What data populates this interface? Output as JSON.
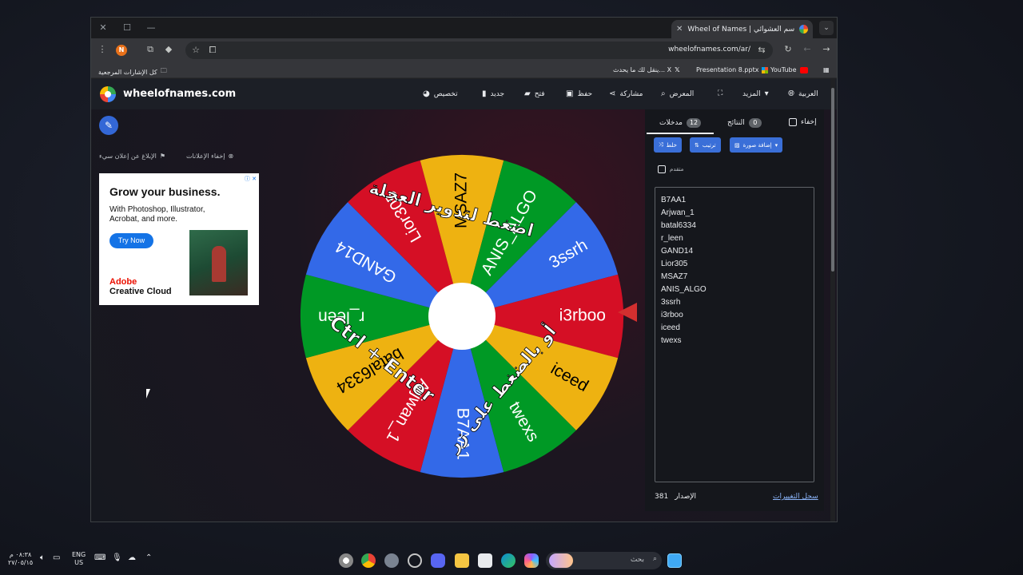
{
  "browser": {
    "tab_title": "Wheel of Names | منتقي الاسم العشوائي",
    "url": "wheelofnames.com/ar/",
    "bookmarks": {
      "all_bookmarks": "كل الإشارات المرجعية",
      "x_item": "ينقل لك ما يحدث... X",
      "presentation": "Presentation 8.pptx",
      "youtube": "YouTube"
    }
  },
  "site": {
    "name": "wheelofnames.com",
    "nav": {
      "customize": "تخصيص",
      "new": "جديد",
      "open": "فتح",
      "save": "حفظ",
      "share": "مشاركة",
      "gallery": "المعرض",
      "more": "المزيد",
      "language": "العربية"
    },
    "ad_links": {
      "hide_ads": "إخفاء الإعلانات",
      "report_ad": "الإبلاغ عن إعلان سيء"
    },
    "ad": {
      "title": "Grow your business.",
      "body": "With Photoshop, Illustrator, Acrobat, and more.",
      "cta": "Try Now",
      "brand_line1": "Adobe",
      "brand_line2": "Creative Cloud"
    }
  },
  "wheel": {
    "slices": [
      "B7AA1",
      "Arjwan_1",
      "batal6334",
      "r_leen",
      "GAND14",
      "Lior305",
      "MSAZ7",
      "ANIS_ALGO",
      "3ssrh",
      "i3rboo",
      "iceed",
      "twexs"
    ],
    "colors": [
      "#3369e8",
      "#d50f25",
      "#eeb211",
      "#009925"
    ],
    "overlay_top": "اضغط لتدوير العجلة",
    "overlay_bottom_ar": "أو بالضغط على زر",
    "overlay_bottom_keys": "Ctrl + Enter"
  },
  "panel": {
    "tab_entries": "مدخلات",
    "entries_count": "12",
    "tab_results": "النتائج",
    "results_count": "0",
    "hide": "إخفاء",
    "shuffle": "خلط",
    "sort": "ترتيب",
    "add_image": "إضافة صورة",
    "advanced": "متقدم",
    "entries": [
      "B7AA1",
      "Arjwan_1",
      "batal6334",
      "r_leen",
      "GAND14",
      "Lior305",
      "MSAZ7",
      "ANIS_ALGO",
      "3ssrh",
      "i3rboo",
      "iceed",
      "twexs"
    ],
    "version_label": "الإصدار",
    "version": "381",
    "changelog": "سجل التغييرات"
  },
  "taskbar": {
    "time": "٠٨:٣٨ م",
    "date": "٢٧/٠٥/١٥",
    "lang_line1": "ENG",
    "lang_line2": "US",
    "search": "بحث"
  }
}
